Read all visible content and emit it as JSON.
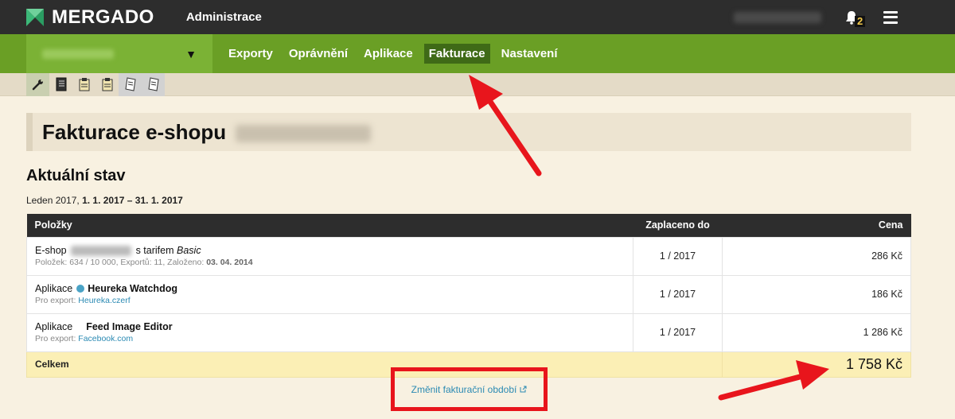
{
  "topbar": {
    "brand": "MERGADO",
    "admin_label": "Administrace",
    "notifications_count": "2"
  },
  "navbar": {
    "items": [
      {
        "label": "Exporty"
      },
      {
        "label": "Oprávnění"
      },
      {
        "label": "Aplikace"
      },
      {
        "label": "Fakturace",
        "active": true
      },
      {
        "label": "Nastavení"
      }
    ]
  },
  "subbar": {
    "icons": [
      "wrench-icon",
      "notebook-icon",
      "clipboard-icon",
      "clipboard-icon",
      "document-icon",
      "document-icon"
    ]
  },
  "page": {
    "title": "Fakturace e-shopu",
    "section_title": "Aktuální stav",
    "period_month": "Leden 2017,",
    "period_range": "1. 1. 2017 – 31. 1. 2017"
  },
  "table": {
    "headers": {
      "items": "Položky",
      "paid_until": "Zaplaceno do",
      "price": "Cena"
    },
    "rows": [
      {
        "prefix": "E-shop",
        "middle": "s tarifem",
        "tariff": "Basic",
        "sub_text": "Položek: 634 / 10 000, Exportů: 11, Založeno:",
        "sub_date": "03. 04. 2014",
        "paid": "1 / 2017",
        "price": "286 Kč"
      },
      {
        "prefix": "Aplikace",
        "name": "Heureka Watchdog",
        "sub_label": "Pro export:",
        "sub_link": "Heureka.czerf",
        "paid": "1 / 2017",
        "price": "186 Kč"
      },
      {
        "prefix": "Aplikace",
        "name": "Feed Image Editor",
        "sub_label": "Pro export:",
        "sub_link": "Facebook.com",
        "paid": "1 / 2017",
        "price": "1 286 Kč"
      }
    ],
    "total_label": "Celkem",
    "total_price": "1 758 Kč"
  },
  "change_period_link": "Změnit fakturační období",
  "colors": {
    "topbar": "#2d2d2d",
    "nav_green": "#6a9f25",
    "nav_active": "#3f6a17",
    "link": "#2b8ab3",
    "annotation_red": "#e8151c",
    "total_row": "#fbefb5"
  }
}
